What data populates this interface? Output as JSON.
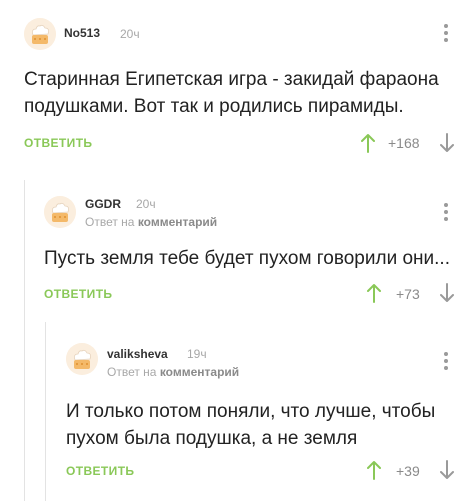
{
  "comments": [
    {
      "username": "No513",
      "time": "20ч",
      "text_lines": [
        "Старинная Египетская игра - закидай фараона",
        "подушками. Вот так и родились пирамиды."
      ],
      "reply_label": "ответить",
      "rating": "+168"
    },
    {
      "username": "GGDR",
      "time": "20ч",
      "reply_prefix": "Ответ на",
      "reply_target": "комментарий",
      "text_lines": [
        "Пусть земля тебе будет пухом говорили они..."
      ],
      "reply_label": "ответить",
      "rating": "+73"
    },
    {
      "username": "valiksheva",
      "time": "19ч",
      "reply_prefix": "Ответ на",
      "reply_target": "комментарий",
      "text_lines": [
        "И только потом поняли, что лучше, чтобы",
        "пухом была подушка, а не земля"
      ],
      "reply_label": "ответить",
      "rating": "+39"
    }
  ],
  "colors": {
    "accent_green": "#8ac858",
    "meta_gray": "#a8a8a8",
    "thread_line": "#e3e3e3"
  },
  "icons": {
    "upvote": "arrow-up-icon",
    "downvote": "arrow-down-icon",
    "menu": "more-vertical-icon",
    "avatar": "default-chef-avatar"
  }
}
